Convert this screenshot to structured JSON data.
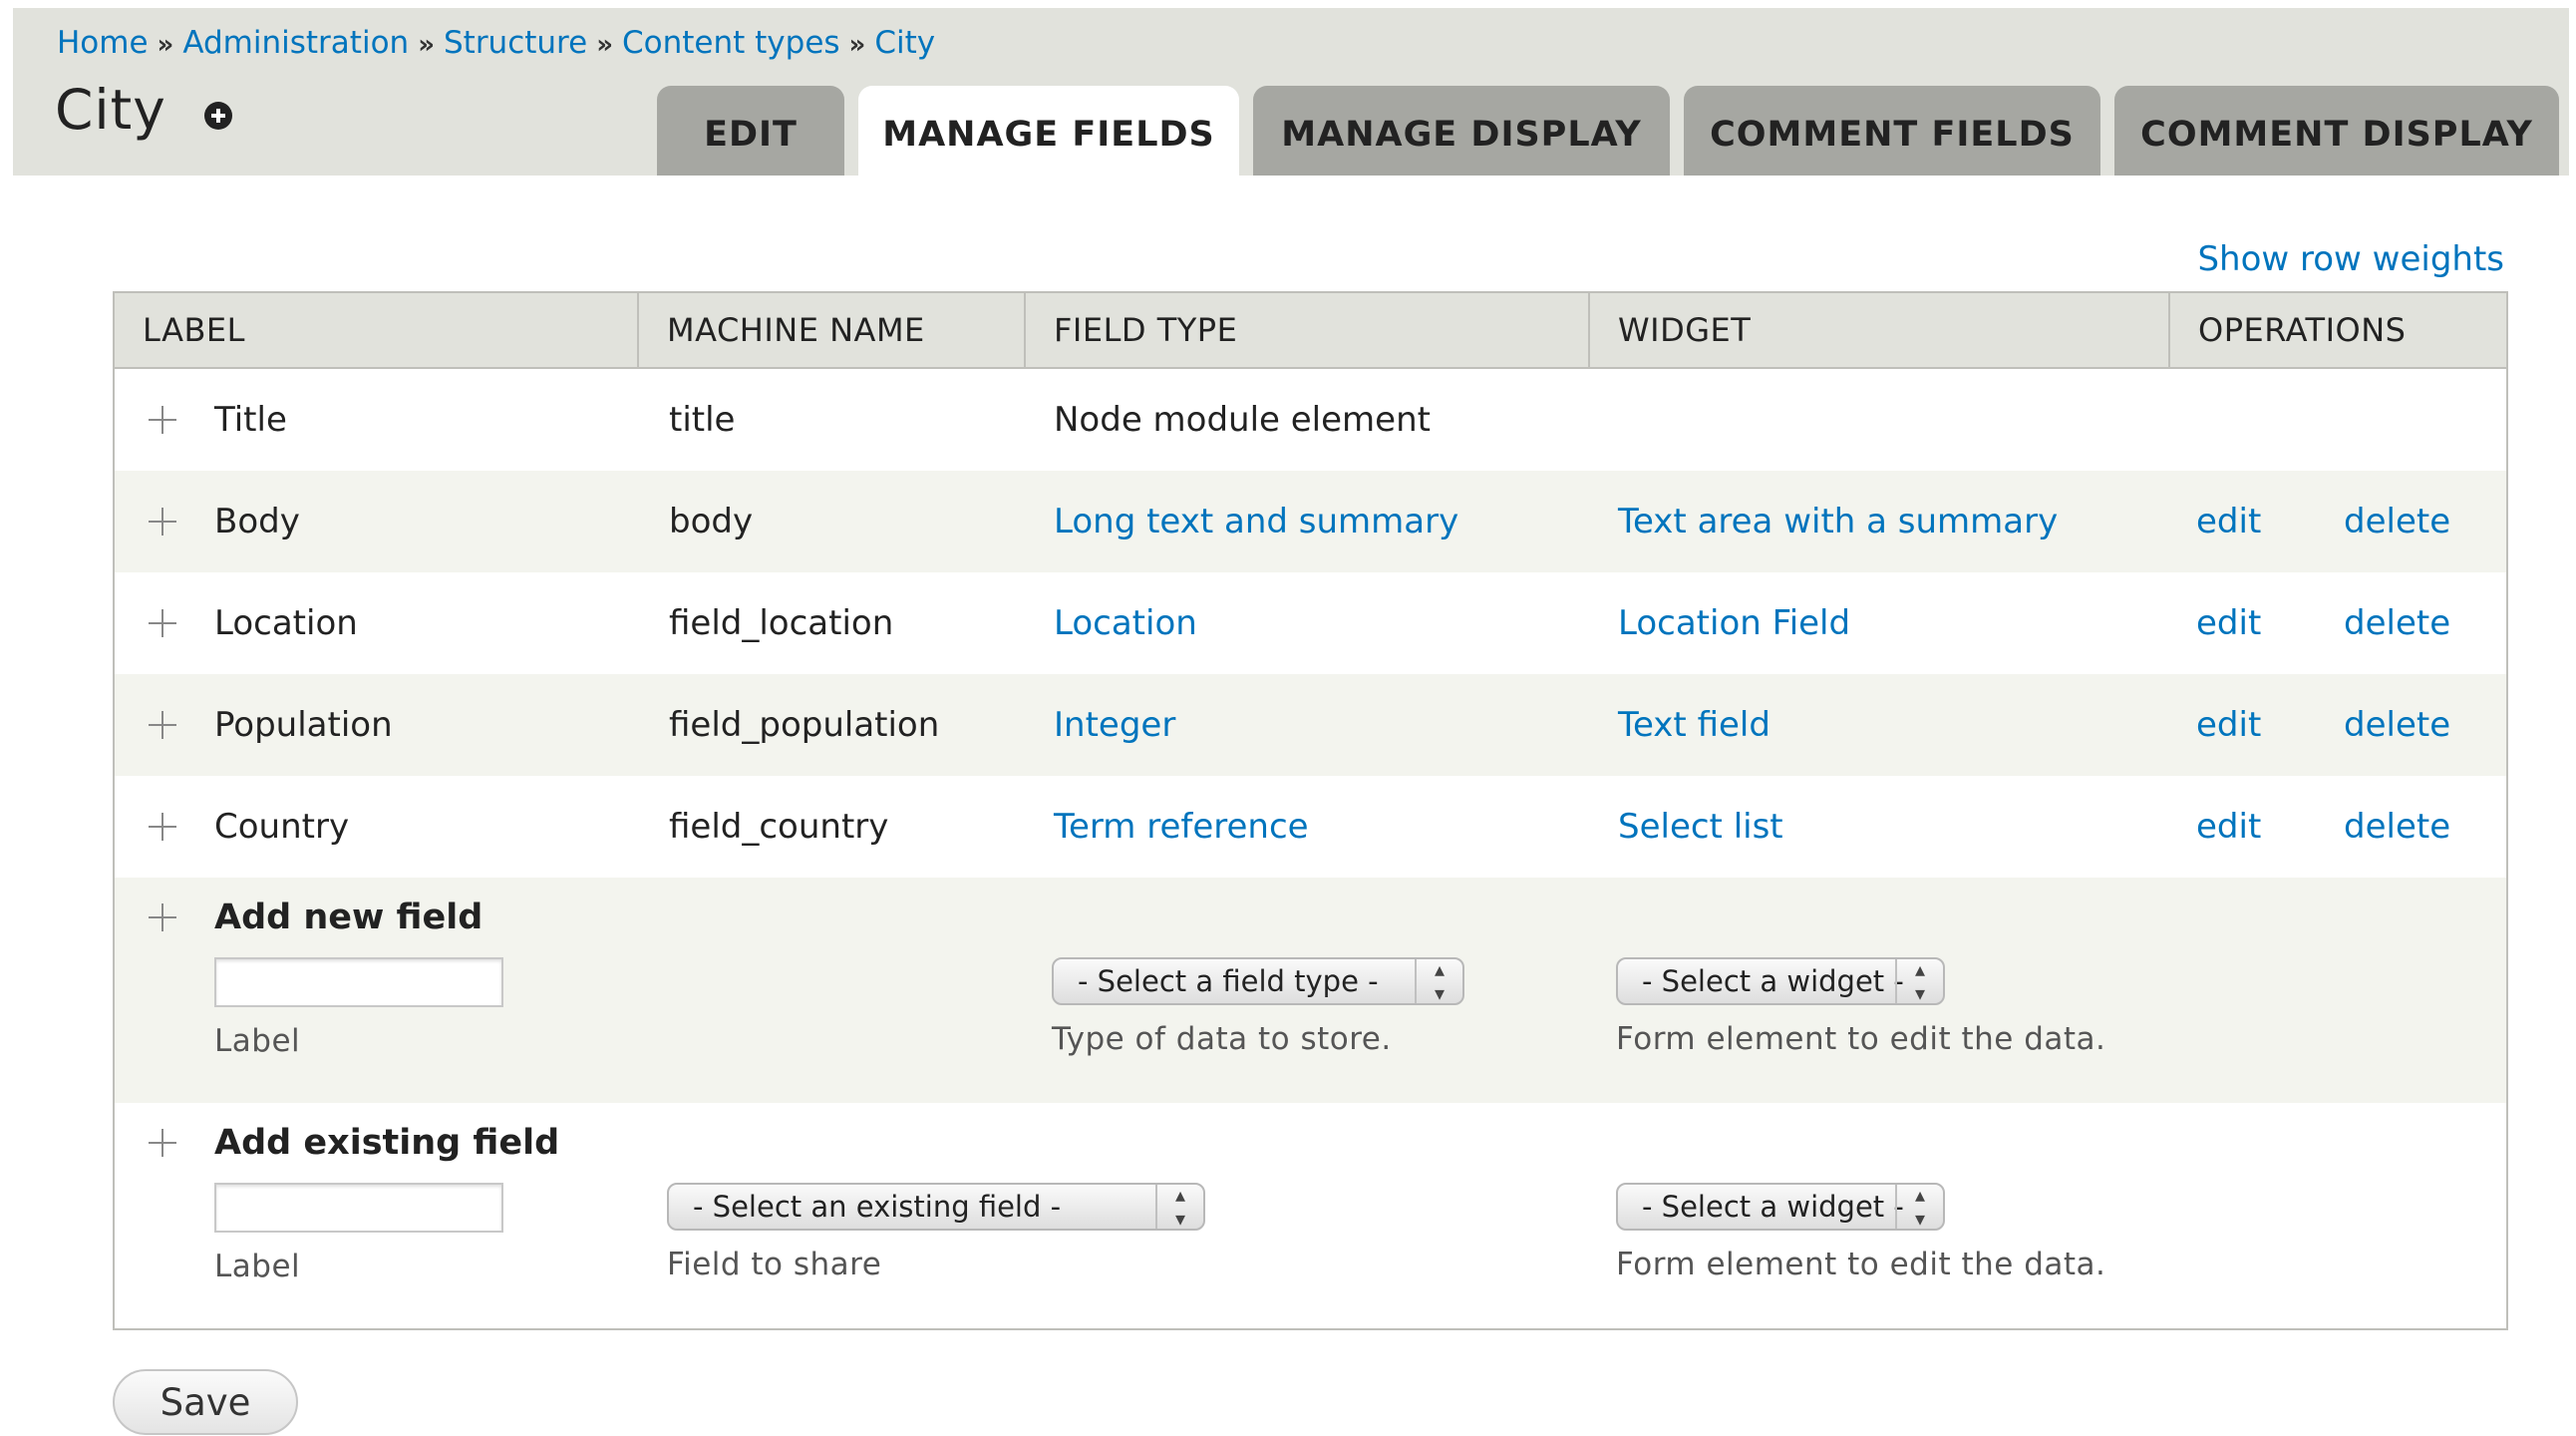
{
  "breadcrumb": {
    "items": [
      "Home",
      "Administration",
      "Structure",
      "Content types",
      "City"
    ],
    "separator": "»"
  },
  "page": {
    "title": "City"
  },
  "tabs": [
    {
      "label": "EDIT",
      "active": false
    },
    {
      "label": "MANAGE FIELDS",
      "active": true
    },
    {
      "label": "MANAGE DISPLAY",
      "active": false
    },
    {
      "label": "COMMENT FIELDS",
      "active": false
    },
    {
      "label": "COMMENT DISPLAY",
      "active": false
    }
  ],
  "row_weights_link": "Show row weights",
  "table": {
    "headers": [
      "LABEL",
      "MACHINE NAME",
      "FIELD TYPE",
      "WIDGET",
      "OPERATIONS"
    ],
    "rows": [
      {
        "label": "Title",
        "machine_name": "title",
        "field_type": "Node module element",
        "field_type_link": false,
        "widget": "",
        "edit": "",
        "delete": ""
      },
      {
        "label": "Body",
        "machine_name": "body",
        "field_type": "Long text and summary",
        "field_type_link": true,
        "widget": "Text area with a summary",
        "edit": "edit",
        "delete": "delete"
      },
      {
        "label": "Location",
        "machine_name": "field_location",
        "field_type": "Location",
        "field_type_link": true,
        "widget": "Location Field",
        "edit": "edit",
        "delete": "delete"
      },
      {
        "label": "Population",
        "machine_name": "field_population",
        "field_type": "Integer",
        "field_type_link": true,
        "widget": "Text field",
        "edit": "edit",
        "delete": "delete"
      },
      {
        "label": "Country",
        "machine_name": "field_country",
        "field_type": "Term reference",
        "field_type_link": true,
        "widget": "Select list",
        "edit": "edit",
        "delete": "delete"
      }
    ],
    "add_new": {
      "heading": "Add new field",
      "label_value": "",
      "label_desc": "Label",
      "field_type_select": "- Select a field type -",
      "field_type_desc": "Type of data to store.",
      "widget_select": "- Select a widget -",
      "widget_desc": "Form element to edit the data."
    },
    "add_existing": {
      "heading": "Add existing field",
      "label_value": "",
      "label_desc": "Label",
      "existing_select": "- Select an existing field -",
      "existing_desc": "Field to share",
      "widget_select": "- Select a widget -",
      "widget_desc": "Form element to edit the data."
    }
  },
  "save_button": "Save",
  "colors": {
    "link": "#0074bd",
    "header_bg": "#e1e2dc",
    "tab_inactive": "#a6a7a2",
    "row_alt": "#f3f4ee"
  }
}
